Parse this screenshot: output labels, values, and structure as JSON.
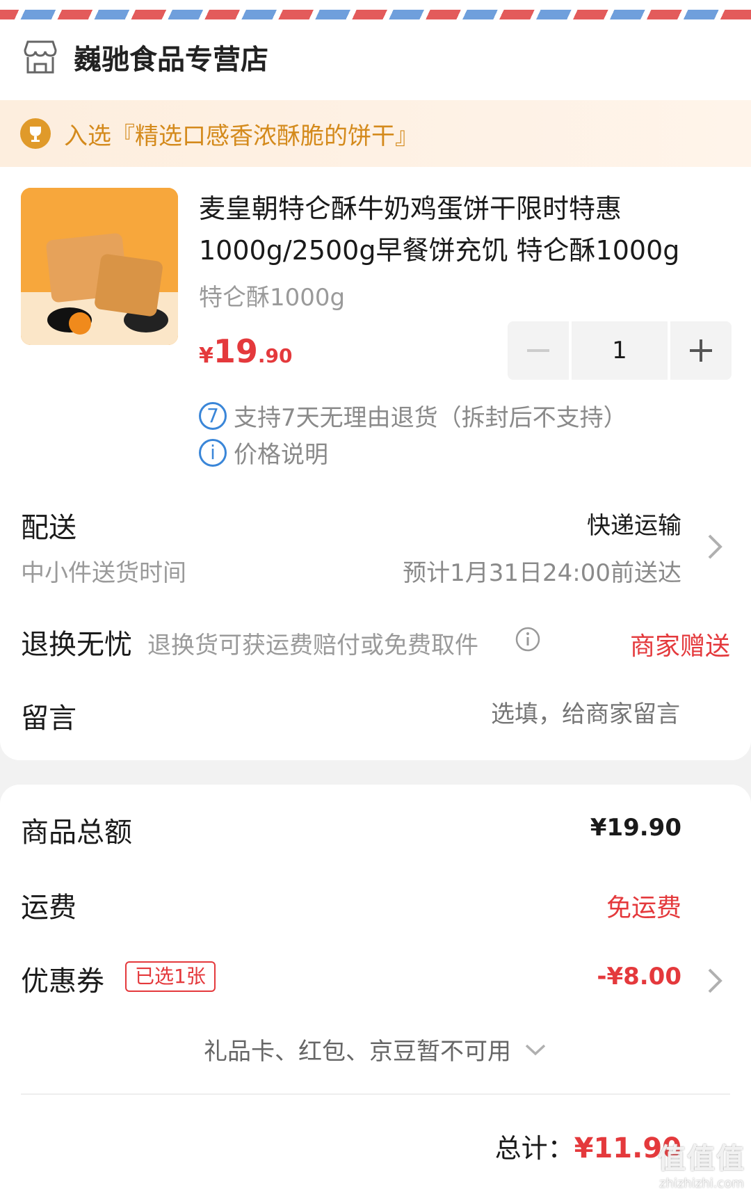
{
  "store": {
    "name": "巍驰食品专营店",
    "icon": "store-icon"
  },
  "award": {
    "text": "入选『精选口感香浓酥脆的饼干』",
    "icon": "trophy-icon",
    "color": "#d48a1c"
  },
  "product": {
    "title": "麦皇朝特仑酥牛奶鸡蛋饼干限时特惠1000g/2500g早餐饼充饥 特仑酥1000g",
    "spec": "特仑酥1000g",
    "price_symbol": "¥",
    "price_int": "19",
    "price_dec": ".90",
    "quantity": "1",
    "services": [
      {
        "badge": "7",
        "text": "支持7天无理由退货（拆封后不支持）"
      },
      {
        "badge": "i",
        "text": "价格说明"
      }
    ]
  },
  "delivery": {
    "label": "配送",
    "method": "快递运输",
    "sub_label": "中小件送货时间",
    "eta": "预计1月31日24:00前送达"
  },
  "return_service": {
    "label": "退换无忧",
    "desc": "退换货可获运费赔付或免费取件",
    "value": "商家赠送"
  },
  "message": {
    "label": "留言",
    "placeholder": "选填，给商家留言"
  },
  "summary": {
    "goods_label": "商品总额",
    "goods_value": "¥19.90",
    "shipping_label": "运费",
    "shipping_value": "免运费",
    "coupon_label": "优惠券",
    "coupon_tag": "已选1张",
    "coupon_value": "-¥8.00",
    "unavailable": "礼品卡、红包、京豆暂不可用",
    "total_label": "总计：",
    "total_value": "¥11.90"
  },
  "watermark": {
    "big": "值值值",
    "small": "zhizhizhi.com"
  },
  "colors": {
    "accent_red": "#e4393c",
    "link_blue": "#3a86d8"
  }
}
